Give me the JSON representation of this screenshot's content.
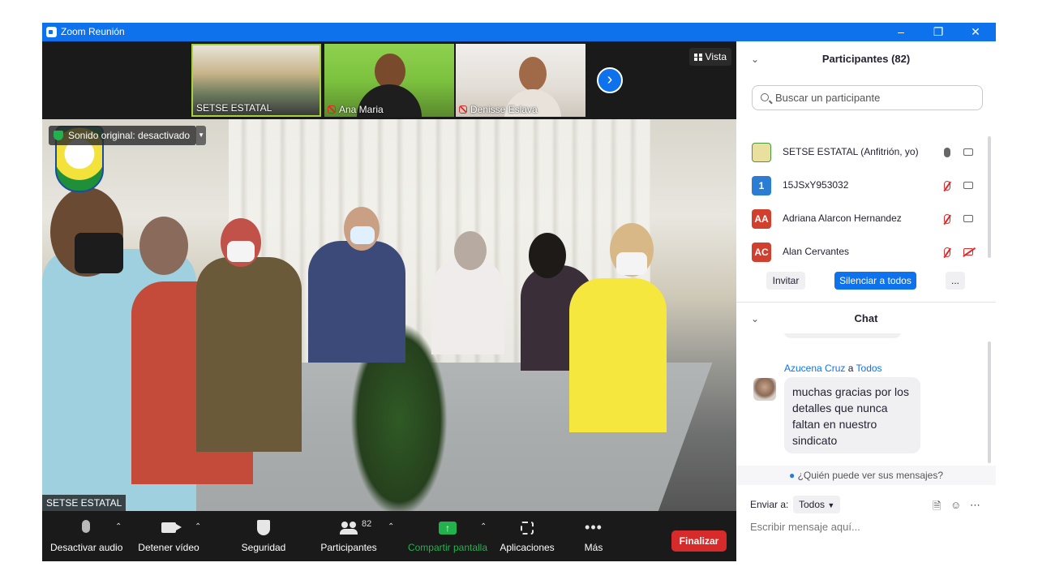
{
  "window": {
    "title": "Zoom Reunión"
  },
  "strip": {
    "thumbs": [
      {
        "name": "SETSE ESTATAL"
      },
      {
        "name": "Ana Maria"
      },
      {
        "name": "Denisse Eslava"
      }
    ],
    "view_label": "Vista"
  },
  "main": {
    "original_sound": "Sonido original: desactivado",
    "speaker_name": "SETSE ESTATAL"
  },
  "toolbar": {
    "audio": "Desactivar audio",
    "video": "Detener vídeo",
    "security": "Seguridad",
    "participants": "Participantes",
    "participants_count": "82",
    "share": "Compartir pantalla",
    "apps": "Aplicaciones",
    "more": "Más",
    "end": "Finalizar"
  },
  "participants": {
    "header": "Participantes (82)",
    "search_placeholder": "Buscar un participante",
    "list": [
      {
        "avatar": "",
        "name": "SETSE ESTATAL (Anfitrión, yo)",
        "mic": "on",
        "cam": "on",
        "color": "#e9e0a0"
      },
      {
        "avatar": "1",
        "name": "15JSxY953032",
        "mic": "muted",
        "cam": "on",
        "color": "#2b7cd3"
      },
      {
        "avatar": "AA",
        "name": "Adriana Alarcon Hernandez",
        "mic": "muted",
        "cam": "on",
        "color": "#d13f2e"
      },
      {
        "avatar": "AC",
        "name": "Alan Cervantes",
        "mic": "muted",
        "cam": "off",
        "color": "#d13f2e"
      }
    ],
    "invite": "Invitar",
    "mute_all": "Silenciar a todos",
    "more": "..."
  },
  "chat": {
    "header": "Chat",
    "message": {
      "sender": "Azucena Cruz",
      "to_word": "a",
      "recipient": "Todos",
      "text": "muchas gracias por los detalles que nunca faltan en nuestro sindicato"
    },
    "who_sees": "¿Quién puede ver sus mensajes?",
    "send_to_label": "Enviar a:",
    "send_to_value": "Todos",
    "input_placeholder": "Escribir mensaje aquí..."
  }
}
